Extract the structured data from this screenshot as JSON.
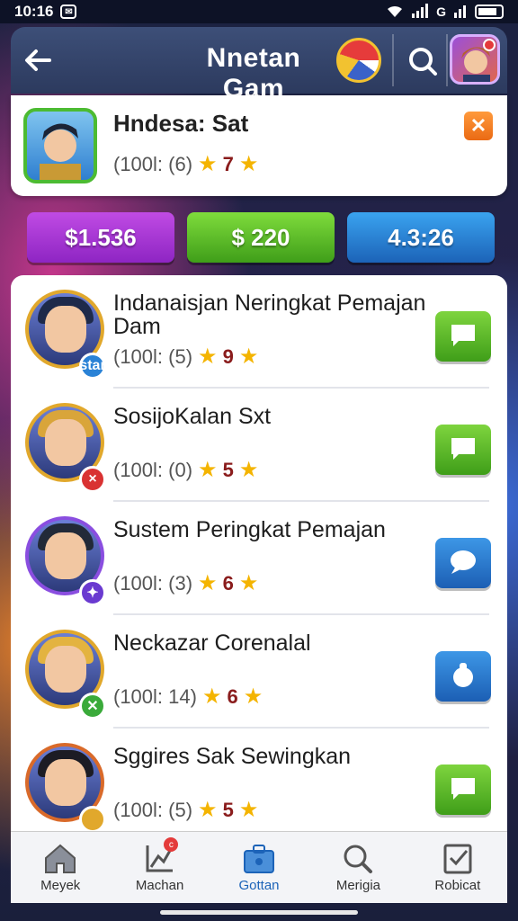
{
  "status_bar": {
    "time": "10:16",
    "notification_icon": "mail-icon",
    "signal_text": "G"
  },
  "header": {
    "title": "Nnetan Gam",
    "back_icon": "back-arrow-icon",
    "game_icon": "game-logo-icon",
    "search_icon": "search-icon",
    "avatar": "profile-avatar"
  },
  "featured": {
    "title": "Hndesa: Sat",
    "count": "(100l: (6)",
    "rating": "7",
    "close_icon": "close-icon"
  },
  "stats": [
    {
      "label": "$1.536",
      "color": "#a83ad6"
    },
    {
      "label": "$ 220",
      "color": "#56b62b"
    },
    {
      "label": "4.3:26",
      "color": "#2a82d6"
    }
  ],
  "players": [
    {
      "name": "Indanaisjan Neringkat Pemajan Dam",
      "count": "(100l: (5)",
      "rating": "9",
      "badge": "star",
      "badge_color": "#2a82d6",
      "action_icon": "chat-icon",
      "action_color": "green",
      "hair": "#1e2a4a",
      "ring": "#e1a82c"
    },
    {
      "name": "SosijoKalan Sxt",
      "count": "(100l: (0)",
      "rating": "5",
      "badge": "×",
      "badge_color": "#d93232",
      "action_icon": "chat-icon",
      "action_color": "green",
      "hair": "#d9a53a",
      "ring": "#e1a82c"
    },
    {
      "name": "Sustem Peringkat Pemajan",
      "count": "(100l: (3)",
      "rating": "6",
      "badge": "✦",
      "badge_color": "#6a3ad0",
      "action_icon": "message-icon",
      "action_color": "blue",
      "hair": "#222a38",
      "ring": "#8a4ee0"
    },
    {
      "name": "Neckazar Corenalal",
      "count": "(100l: 14)",
      "rating": "6",
      "badge": "✕",
      "badge_color": "#3aaa3a",
      "action_icon": "bag-icon",
      "action_color": "blue",
      "hair": "#e3b340",
      "ring": "#e1a82c"
    },
    {
      "name": "Sggires Sak Sewingkan",
      "count": "(100l: (5)",
      "rating": "5",
      "badge": "",
      "badge_color": "#e1a82c",
      "action_icon": "chat-icon",
      "action_color": "green",
      "hair": "#1c1c24",
      "ring": "#d96a2a"
    }
  ],
  "nav": [
    {
      "label": "Meyek",
      "icon": "home-icon"
    },
    {
      "label": "Machan",
      "icon": "chart-icon",
      "badge": "c"
    },
    {
      "label": "Gottan",
      "icon": "briefcase-icon",
      "active": true
    },
    {
      "label": "Merigia",
      "icon": "search-icon"
    },
    {
      "label": "Robicat",
      "icon": "checklist-icon"
    }
  ]
}
